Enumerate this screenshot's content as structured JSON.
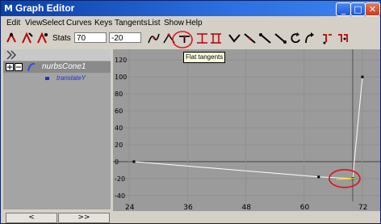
{
  "window": {
    "title": "Graph Editor",
    "title_icon": "maya-icon",
    "controls": [
      "minimize",
      "maximize",
      "close"
    ]
  },
  "menu": [
    "Edit",
    "View",
    "Select",
    "Curves",
    "Keys",
    "Tangents",
    "List",
    "Show",
    "Help"
  ],
  "toolbar": {
    "stats_label": "Stats",
    "time_value": "70",
    "key_value": "-20",
    "tooltip": "Flat tangents",
    "tools": [
      "move-key-tool",
      "insert-key-tool",
      "add-key-tool",
      "spline-tangents",
      "linear-tangents",
      "flat-tangents",
      "step-tangents",
      "clamped-tangents",
      "break-tangents",
      "unify-tangents",
      "weighted-tangents",
      "free-tangent-weight",
      "lock-tangent-weight",
      "cycle-icon",
      "buffer-curve-icon",
      "snapshot-icon",
      "swap-buffer-icon"
    ]
  },
  "outliner": {
    "node": "nurbsCone1",
    "attribute": "translateY"
  },
  "scroll": {
    "left": "<",
    "right": ">>"
  },
  "chart_data": {
    "type": "line",
    "x_ticks": [
      24,
      36,
      48,
      60,
      72
    ],
    "y_ticks": [
      120,
      100,
      80,
      60,
      40,
      20,
      0,
      -20,
      -40
    ],
    "xlim": [
      24,
      74
    ],
    "ylim": [
      -45,
      125
    ],
    "current_time": 70,
    "time_label": "70",
    "series": [
      {
        "values": [
          [
            25,
            0
          ],
          [
            63,
            -18
          ],
          [
            70,
            -20
          ],
          [
            72,
            100
          ]
        ]
      }
    ],
    "selected_key": [
      70,
      -20
    ],
    "annotations": [
      "red circle around key at 70",
      "red circle around flat tangents button"
    ]
  }
}
